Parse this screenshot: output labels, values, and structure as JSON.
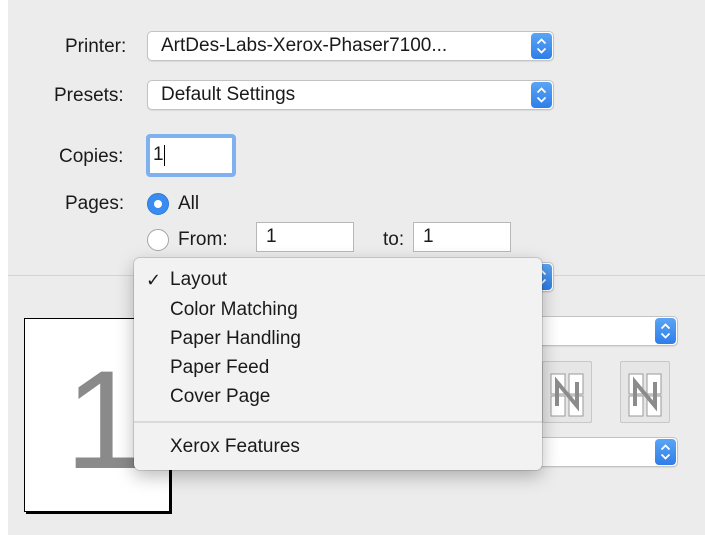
{
  "printer": {
    "label": "Printer:",
    "value": "ArtDes-Labs-Xerox-Phaser7100..."
  },
  "presets": {
    "label": "Presets:",
    "value": "Default Settings"
  },
  "copies": {
    "label": "Copies:",
    "value": "1"
  },
  "pages": {
    "label": "Pages:",
    "all_label": "All",
    "from_label": "From:",
    "from_value": "1",
    "to_label": "to:",
    "to_value": "1",
    "selected": "All"
  },
  "preview": {
    "page_number": "1"
  },
  "section_menu": {
    "selected": "Layout",
    "checkmark": "✓",
    "items": [
      "Layout",
      "Color Matching",
      "Paper Handling",
      "Paper Feed",
      "Cover Page"
    ],
    "extra_items": [
      "Xerox Features"
    ]
  },
  "colors": {
    "accent": "#3a8cf0",
    "focus_ring": "#7fb1ee",
    "background": "#ececec"
  },
  "icons": {
    "stepper": "up-down-chevron-icon",
    "layout_z": "layout-direction-z-icon",
    "layout_n": "layout-direction-n-icon"
  }
}
